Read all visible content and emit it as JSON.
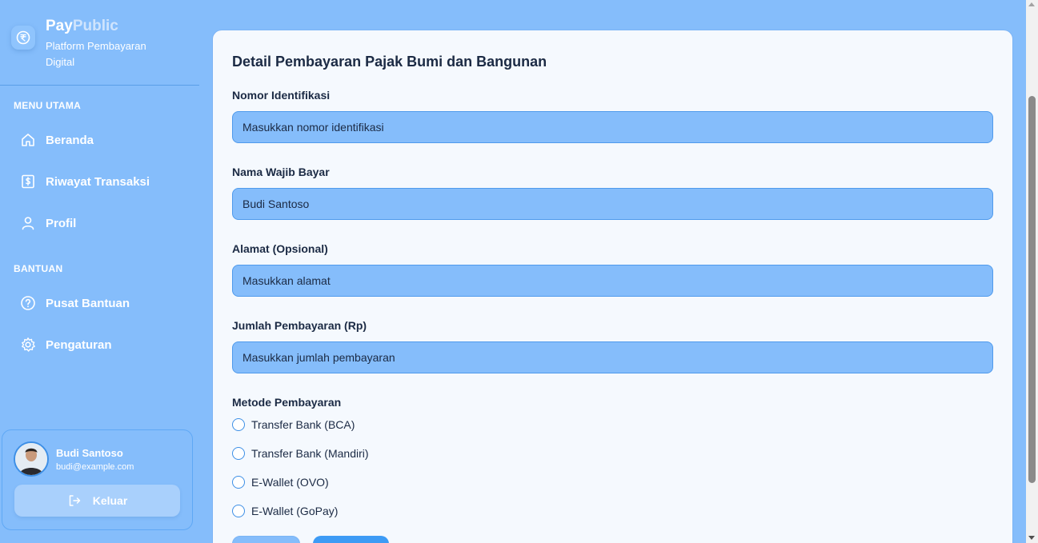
{
  "brand": {
    "name_part1": "Pay",
    "name_part2": "Public",
    "subtitle": "Platform Pembayaran Digital",
    "logo_icon": "rupee-coin-icon"
  },
  "sidebar": {
    "main_section_title": "MENU UTAMA",
    "main_items": [
      {
        "label": "Beranda",
        "icon": "home-icon"
      },
      {
        "label": "Riwayat Transaksi",
        "icon": "receipt-dollar-icon"
      },
      {
        "label": "Profil",
        "icon": "user-icon"
      }
    ],
    "help_section_title": "BANTUAN",
    "help_items": [
      {
        "label": "Pusat Bantuan",
        "icon": "question-circle-icon"
      },
      {
        "label": "Pengaturan",
        "icon": "gear-icon"
      }
    ]
  },
  "user": {
    "name": "Budi Santoso",
    "email": "budi@example.com",
    "logout_label": "Keluar"
  },
  "form": {
    "title": "Detail Pembayaran Pajak Bumi dan Bangunan",
    "fields": [
      {
        "label": "Nomor Identifikasi",
        "value": "",
        "placeholder": "Masukkan nomor identifikasi"
      },
      {
        "label": "Nama Wajib Bayar",
        "value": "Budi Santoso",
        "placeholder": ""
      },
      {
        "label": "Alamat (Opsional)",
        "value": "",
        "placeholder": "Masukkan alamat"
      },
      {
        "label": "Jumlah Pembayaran (Rp)",
        "value": "",
        "placeholder": "Masukkan jumlah pembayaran"
      }
    ],
    "payment_method_label": "Metode Pembayaran",
    "payment_methods": [
      "Transfer Bank (BCA)",
      "Transfer Bank (Mandiri)",
      "E-Wallet (OVO)",
      "E-Wallet (GoPay)"
    ]
  },
  "colors": {
    "background": "#85bdfb",
    "card": "#f5f9fe",
    "accent": "#3d8fe6",
    "text_dark": "#1b2a44"
  }
}
